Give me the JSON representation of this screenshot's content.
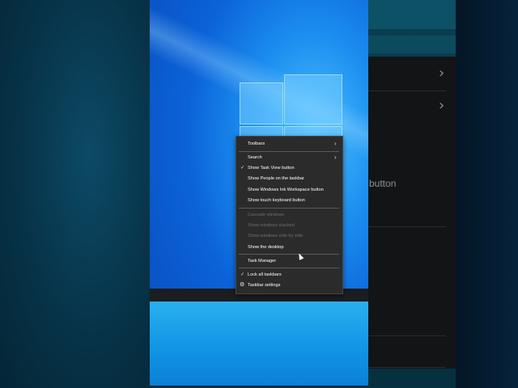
{
  "background_right": {
    "partial_text": "button"
  },
  "context_menu": {
    "items": [
      {
        "label": "Toolbars",
        "submenu": true
      },
      {
        "label": "Search",
        "submenu": true
      },
      {
        "label": "Show Task View button",
        "checked": true
      },
      {
        "label": "Show People on the taskbar"
      },
      {
        "label": "Show Windows Ink Workspace button"
      },
      {
        "label": "Show touch keyboard button"
      },
      {
        "label": "Cascade windows",
        "disabled": true
      },
      {
        "label": "Show windows stacked",
        "disabled": true
      },
      {
        "label": "Show windows side by side",
        "disabled": true
      },
      {
        "label": "Show the desktop"
      },
      {
        "label": "Task Manager"
      },
      {
        "label": "Lock all taskbars",
        "checked": true
      },
      {
        "label": "Taskbar settings",
        "icon": "gear-icon"
      }
    ]
  },
  "colors": {
    "menu_bg": "#2b2b2b",
    "taskbar": "#1b1d20",
    "wallpaper_accent": "#1c8ff0"
  }
}
